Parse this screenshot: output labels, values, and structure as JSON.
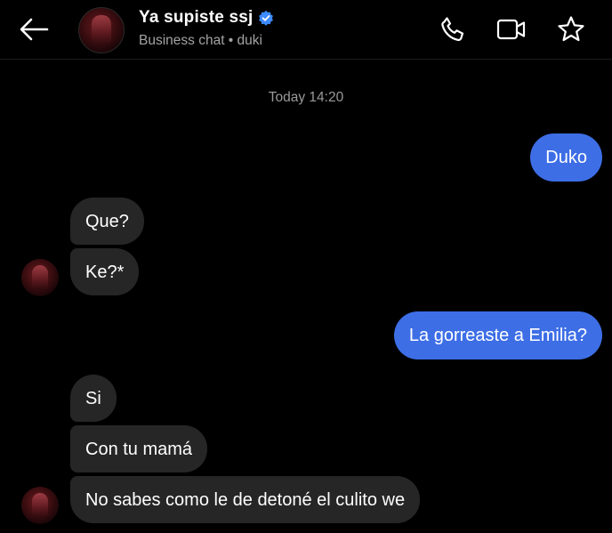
{
  "header": {
    "title": "Ya supiste ssj",
    "subtitle": "Business chat • duki",
    "verified": true,
    "accent_color": "#3d8bff",
    "icons": [
      "back-arrow-icon",
      "phone-icon",
      "video-camera-icon",
      "star-icon"
    ]
  },
  "conversation": {
    "timestamp": "Today 14:20",
    "colors": {
      "outgoing_bubble": "#3d6ee6",
      "incoming_bubble": "#262626",
      "background": "#000000"
    },
    "messages": [
      {
        "direction": "outgoing",
        "text": "Duko"
      },
      {
        "direction": "incoming",
        "text": "Que?"
      },
      {
        "direction": "incoming",
        "text": "Ke?*"
      },
      {
        "direction": "outgoing",
        "text": "La gorreaste a Emilia?"
      },
      {
        "direction": "incoming",
        "text": "Si"
      },
      {
        "direction": "incoming",
        "text": "Con tu mamá"
      },
      {
        "direction": "incoming",
        "text": "No sabes como le de detoné el culito we"
      }
    ]
  }
}
